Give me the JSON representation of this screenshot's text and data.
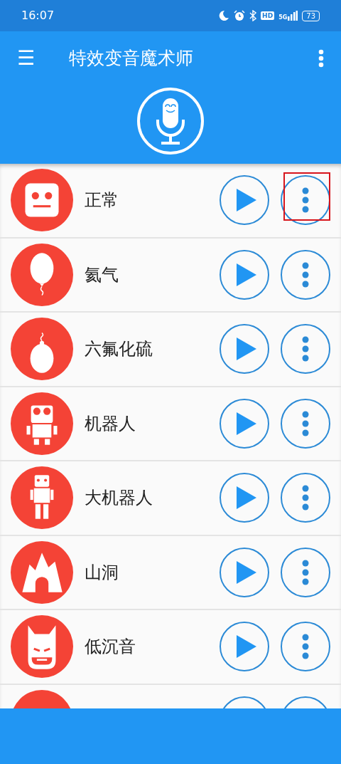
{
  "status_bar": {
    "time": "16:07",
    "hd_label": "HD",
    "network_label": "5G",
    "battery": "73"
  },
  "app_bar": {
    "menu_glyph": "☰",
    "title": "特效变音魔术师"
  },
  "effects": [
    {
      "kind": "robot-face",
      "name": "正常",
      "highlighted": true
    },
    {
      "kind": "balloon",
      "name": "氦气",
      "highlighted": false
    },
    {
      "kind": "egg-balloon",
      "name": "六氟化硫",
      "highlighted": false
    },
    {
      "kind": "robot",
      "name": "机器人",
      "highlighted": false
    },
    {
      "kind": "tall-robot",
      "name": "大机器人",
      "highlighted": false
    },
    {
      "kind": "cave",
      "name": "山洞",
      "highlighted": false
    },
    {
      "kind": "mask",
      "name": "低沉音",
      "highlighted": false
    },
    {
      "kind": "hidden",
      "highlighted": false
    }
  ]
}
